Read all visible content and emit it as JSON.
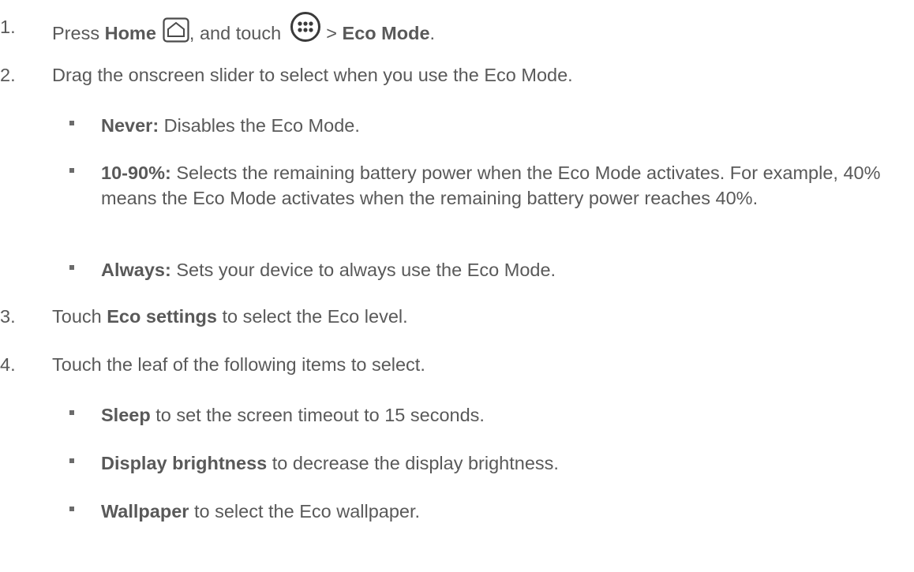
{
  "steps": [
    {
      "num": "1.",
      "parts": {
        "a": "Press ",
        "b": "Home",
        "c": ", and touch ",
        "d": " > ",
        "e": "Eco Mode",
        "f": "."
      },
      "icons": [
        "home-icon",
        "apps-icon"
      ]
    },
    {
      "num": "2.",
      "text": "Drag the onscreen slider to select when you use the Eco Mode.",
      "bullets": [
        {
          "bold": "Never:",
          "text": " Disables the Eco Mode."
        },
        {
          "bold": "10-90%:",
          "text": " Selects the remaining battery power when the Eco Mode activates. For example, 40% means the Eco Mode activates when the remaining battery power reaches 40%."
        },
        {
          "bold": "Always:",
          "text": " Sets your device to always use the Eco Mode."
        }
      ]
    },
    {
      "num": "3.",
      "parts": {
        "a": "Touch ",
        "b": "Eco settings",
        "c": " to select the Eco level."
      }
    },
    {
      "num": "4.",
      "text": "Touch the leaf of the following items to select.",
      "bullets": [
        {
          "bold": "Sleep",
          "text": " to set the screen timeout to 15 seconds."
        },
        {
          "bold": "Display brightness",
          "text": " to decrease the display brightness."
        },
        {
          "bold": "Wallpaper",
          "text": " to select the Eco wallpaper."
        }
      ]
    }
  ],
  "colors": {
    "text": "#595959",
    "bullet": "#6b6b6b"
  }
}
